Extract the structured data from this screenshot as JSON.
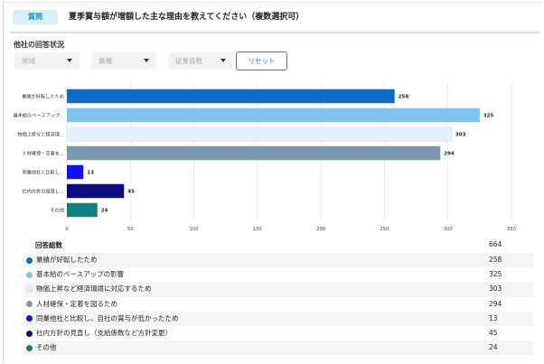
{
  "question": {
    "badge": "質問",
    "text": "夏季賞与額が増額した主な理由を教えてください（複数選択可）"
  },
  "section_title": "他社の回答状況",
  "filters": [
    {
      "placeholder": "地域"
    },
    {
      "placeholder": "業種"
    },
    {
      "placeholder": "従業員数"
    }
  ],
  "reset_label": "リセット",
  "chart_data": {
    "type": "bar",
    "orientation": "horizontal",
    "categories": [
      "業績が好転したため",
      "基本給のベースアップ...",
      "物価上昇など経済環...",
      "人材確保・定着を...",
      "同業他社と比較し...",
      "社内方針の見直し...",
      "その他"
    ],
    "values": [
      258,
      325,
      303,
      294,
      13,
      45,
      24
    ],
    "colors": [
      "#0a6cc4",
      "#7fc2ea",
      "#e4f1fc",
      "#7d98ae",
      "#1010ee",
      "#0c0c7e",
      "#0f8080"
    ],
    "xlim": [
      0,
      350
    ],
    "xticks": [
      0,
      50,
      100,
      150,
      200,
      250,
      300,
      350
    ],
    "grid": true
  },
  "summary": {
    "total_label": "回答総数",
    "total_value": "664",
    "rows": [
      {
        "label": "業績が好転したため",
        "value": "258",
        "color": "#0a6cc4"
      },
      {
        "label": "基本給のベースアップの影響",
        "value": "325",
        "color": "#7fc2ea"
      },
      {
        "label": "物価上昇など経済環境に対応するため",
        "value": "303",
        "color": "#e4f1fc"
      },
      {
        "label": "人材確保・定着を図るため",
        "value": "294",
        "color": "#7d98ae"
      },
      {
        "label": "同業他社と比較し、自社の賞与が低かったため",
        "value": "13",
        "color": "#1010ee"
      },
      {
        "label": "社内方針の見直し（支給係数など方針変更）",
        "value": "45",
        "color": "#0c0c7e"
      },
      {
        "label": "その他",
        "value": "24",
        "color": "#0f8080"
      }
    ]
  }
}
